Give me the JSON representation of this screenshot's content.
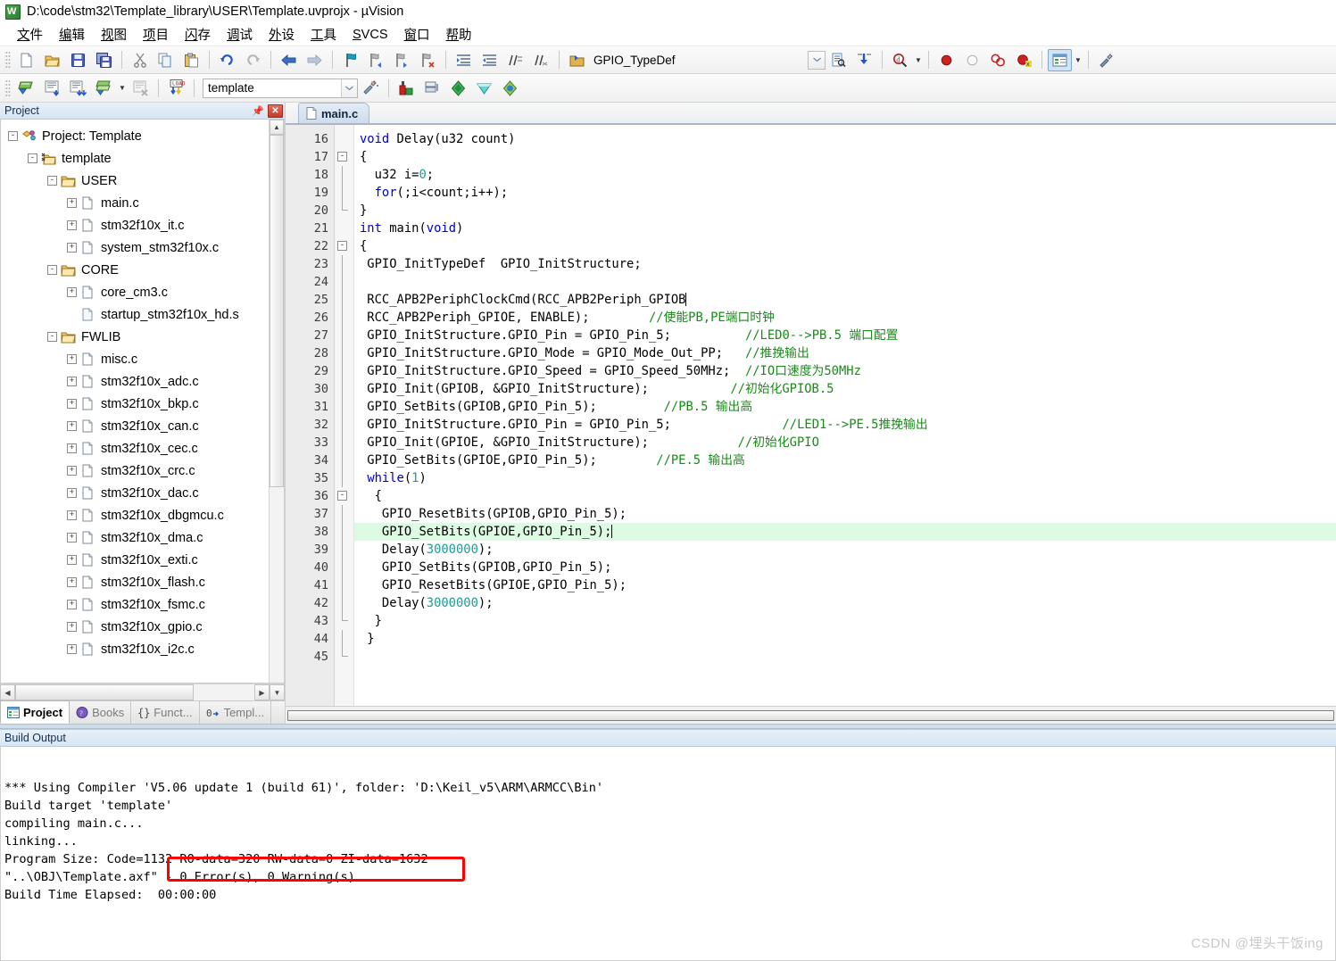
{
  "window": {
    "title": "D:\\code\\stm32\\Template_library\\USER\\Template.uvprojx - µVision",
    "app_icon": "uvision-icon"
  },
  "menu": [
    {
      "label": "文件"
    },
    {
      "label": "编辑"
    },
    {
      "label": "视图"
    },
    {
      "label": "项目"
    },
    {
      "label": "闪存"
    },
    {
      "label": "调试"
    },
    {
      "label": "外设"
    },
    {
      "label": "工具"
    },
    {
      "label": "SVCS"
    },
    {
      "label": "窗口"
    },
    {
      "label": "帮助"
    }
  ],
  "toolbar1": {
    "symbol_field": "GPIO_TypeDef",
    "buttons": [
      "new-file-icon",
      "open-file-icon",
      "save-icon",
      "save-all-icon",
      "cut-icon",
      "copy-icon",
      "paste-icon",
      "undo-icon",
      "redo-icon",
      "navigate-back-icon",
      "navigate-forward-icon",
      "bookmark-toggle-icon",
      "bookmark-prev-icon",
      "bookmark-next-icon",
      "bookmark-clear-icon",
      "indent-icon",
      "outdent-icon",
      "comment-icon",
      "uncomment-icon",
      "browse-symbol-icon"
    ],
    "right_buttons": [
      "find-in-files-icon",
      "goto-definition-icon",
      "find-icon",
      "breakpoint-insert-icon",
      "breakpoint-disable-icon",
      "breakpoint-kill-all-icon",
      "breakpoint-disable-all-icon",
      "manage-windows-icon",
      "configuration-wizard-icon"
    ]
  },
  "toolbar2": {
    "target_name": "template",
    "buttons": [
      "translate-icon",
      "build-icon",
      "rebuild-icon",
      "batch-build-icon",
      "stop-build-icon",
      "download-icon"
    ],
    "right_buttons": [
      "target-options-icon",
      "manage-project-items-icon",
      "pack-installer-icon",
      "manage-runtime-env-icon",
      "select-software-packs-icon"
    ]
  },
  "project_panel": {
    "title": "Project",
    "pin_icon": "pin-icon",
    "close_icon": "close-icon",
    "tree": [
      {
        "label": "Project: Template",
        "indent": 0,
        "expander": "-",
        "icon": "project-icon"
      },
      {
        "label": "template",
        "indent": 1,
        "expander": "-",
        "icon": "target-icon"
      },
      {
        "label": "USER",
        "indent": 2,
        "expander": "-",
        "icon": "folder-icon"
      },
      {
        "label": "main.c",
        "indent": 3,
        "expander": "+",
        "icon": "c-file-icon"
      },
      {
        "label": "stm32f10x_it.c",
        "indent": 3,
        "expander": "+",
        "icon": "c-file-icon"
      },
      {
        "label": "system_stm32f10x.c",
        "indent": 3,
        "expander": "+",
        "icon": "c-file-icon"
      },
      {
        "label": "CORE",
        "indent": 2,
        "expander": "-",
        "icon": "folder-icon"
      },
      {
        "label": "core_cm3.c",
        "indent": 3,
        "expander": "+",
        "icon": "c-file-icon"
      },
      {
        "label": "startup_stm32f10x_hd.s",
        "indent": 3,
        "expander": "",
        "icon": "asm-file-icon"
      },
      {
        "label": "FWLIB",
        "indent": 2,
        "expander": "-",
        "icon": "folder-icon"
      },
      {
        "label": "misc.c",
        "indent": 3,
        "expander": "+",
        "icon": "c-file-icon"
      },
      {
        "label": "stm32f10x_adc.c",
        "indent": 3,
        "expander": "+",
        "icon": "c-file-icon"
      },
      {
        "label": "stm32f10x_bkp.c",
        "indent": 3,
        "expander": "+",
        "icon": "c-file-icon"
      },
      {
        "label": "stm32f10x_can.c",
        "indent": 3,
        "expander": "+",
        "icon": "c-file-icon"
      },
      {
        "label": "stm32f10x_cec.c",
        "indent": 3,
        "expander": "+",
        "icon": "c-file-icon"
      },
      {
        "label": "stm32f10x_crc.c",
        "indent": 3,
        "expander": "+",
        "icon": "c-file-icon"
      },
      {
        "label": "stm32f10x_dac.c",
        "indent": 3,
        "expander": "+",
        "icon": "c-file-icon"
      },
      {
        "label": "stm32f10x_dbgmcu.c",
        "indent": 3,
        "expander": "+",
        "icon": "c-file-icon"
      },
      {
        "label": "stm32f10x_dma.c",
        "indent": 3,
        "expander": "+",
        "icon": "c-file-icon"
      },
      {
        "label": "stm32f10x_exti.c",
        "indent": 3,
        "expander": "+",
        "icon": "c-file-icon"
      },
      {
        "label": "stm32f10x_flash.c",
        "indent": 3,
        "expander": "+",
        "icon": "c-file-icon"
      },
      {
        "label": "stm32f10x_fsmc.c",
        "indent": 3,
        "expander": "+",
        "icon": "c-file-icon"
      },
      {
        "label": "stm32f10x_gpio.c",
        "indent": 3,
        "expander": "+",
        "icon": "c-file-icon"
      },
      {
        "label": "stm32f10x_i2c.c",
        "indent": 3,
        "expander": "+",
        "icon": "c-file-icon"
      }
    ],
    "tabs": [
      {
        "label": "Project",
        "icon": "project-tab-icon",
        "active": true
      },
      {
        "label": "Books",
        "icon": "books-tab-icon",
        "active": false
      },
      {
        "label": "Funct...",
        "icon": "functions-tab-icon",
        "active": false
      },
      {
        "label": "Templ...",
        "icon": "templates-tab-icon",
        "active": false
      }
    ]
  },
  "editor": {
    "tab": {
      "label": "main.c",
      "icon": "c-file-icon"
    },
    "first_line": 16,
    "highlight_line": 38,
    "caret_line": 38,
    "lines": [
      {
        "n": 16,
        "fold": "",
        "tokens": [
          {
            "t": "kw",
            "s": "void "
          },
          {
            "t": "p",
            "s": "Delay(u32 count)"
          }
        ]
      },
      {
        "n": 17,
        "fold": "-",
        "tokens": [
          {
            "t": "p",
            "s": "{"
          }
        ]
      },
      {
        "n": 18,
        "fold": "|",
        "tokens": [
          {
            "t": "p",
            "s": "  u32 i="
          },
          {
            "t": "num",
            "s": "0"
          },
          {
            "t": "p",
            "s": ";"
          }
        ]
      },
      {
        "n": 19,
        "fold": "|",
        "tokens": [
          {
            "t": "p",
            "s": "  "
          },
          {
            "t": "kw",
            "s": "for"
          },
          {
            "t": "p",
            "s": "(;i<count;i++);"
          }
        ]
      },
      {
        "n": 20,
        "fold": "e",
        "tokens": [
          {
            "t": "p",
            "s": "}"
          }
        ]
      },
      {
        "n": 21,
        "fold": "",
        "tokens": [
          {
            "t": "kw",
            "s": "int "
          },
          {
            "t": "p",
            "s": "main("
          },
          {
            "t": "kw",
            "s": "void"
          },
          {
            "t": "p",
            "s": ")"
          }
        ]
      },
      {
        "n": 22,
        "fold": "-",
        "tokens": [
          {
            "t": "p",
            "s": "{"
          }
        ]
      },
      {
        "n": 23,
        "fold": "|",
        "tokens": [
          {
            "t": "p",
            "s": " GPIO_InitTypeDef  GPIO_InitStructure;"
          }
        ]
      },
      {
        "n": 24,
        "fold": "|",
        "tokens": [
          {
            "t": "p",
            "s": ""
          }
        ]
      },
      {
        "n": 25,
        "fold": "|",
        "tokens": [
          {
            "t": "p",
            "s": " RCC_APB2PeriphClockCmd(RCC_APB2Periph_GPIOB"
          },
          {
            "t": "caret",
            "s": ""
          }
        ]
      },
      {
        "n": 26,
        "fold": "|",
        "tokens": [
          {
            "t": "p",
            "s": " RCC_APB2Periph_GPIOE, ENABLE);        "
          },
          {
            "t": "cmt",
            "s": "//使能PB,PE端口时钟"
          }
        ]
      },
      {
        "n": 27,
        "fold": "|",
        "tokens": [
          {
            "t": "p",
            "s": " GPIO_InitStructure.GPIO_Pin = GPIO_Pin_5;          "
          },
          {
            "t": "cmt",
            "s": "//LED0-->PB.5 端口配置"
          }
        ]
      },
      {
        "n": 28,
        "fold": "|",
        "tokens": [
          {
            "t": "p",
            "s": " GPIO_InitStructure.GPIO_Mode = GPIO_Mode_Out_PP;   "
          },
          {
            "t": "cmt",
            "s": "//推挽输出"
          }
        ]
      },
      {
        "n": 29,
        "fold": "|",
        "tokens": [
          {
            "t": "p",
            "s": " GPIO_InitStructure.GPIO_Speed = GPIO_Speed_50MHz;  "
          },
          {
            "t": "cmt",
            "s": "//IO口速度为50MHz"
          }
        ]
      },
      {
        "n": 30,
        "fold": "|",
        "tokens": [
          {
            "t": "p",
            "s": " GPIO_Init(GPIOB, &GPIO_InitStructure);           "
          },
          {
            "t": "cmt",
            "s": "//初始化GPIOB.5"
          }
        ]
      },
      {
        "n": 31,
        "fold": "|",
        "tokens": [
          {
            "t": "p",
            "s": " GPIO_SetBits(GPIOB,GPIO_Pin_5);         "
          },
          {
            "t": "cmt",
            "s": "//PB.5 输出高"
          }
        ]
      },
      {
        "n": 32,
        "fold": "|",
        "tokens": [
          {
            "t": "p",
            "s": " GPIO_InitStructure.GPIO_Pin = GPIO_Pin_5;               "
          },
          {
            "t": "cmt",
            "s": "//LED1-->PE.5推挽输出"
          }
        ]
      },
      {
        "n": 33,
        "fold": "|",
        "tokens": [
          {
            "t": "p",
            "s": " GPIO_Init(GPIOE, &GPIO_InitStructure);            "
          },
          {
            "t": "cmt",
            "s": "//初始化GPIO"
          }
        ]
      },
      {
        "n": 34,
        "fold": "|",
        "tokens": [
          {
            "t": "p",
            "s": " GPIO_SetBits(GPIOE,GPIO_Pin_5);        "
          },
          {
            "t": "cmt",
            "s": "//PE.5 输出高"
          }
        ]
      },
      {
        "n": 35,
        "fold": "|",
        "tokens": [
          {
            "t": "p",
            "s": " "
          },
          {
            "t": "kw",
            "s": "while"
          },
          {
            "t": "p",
            "s": "("
          },
          {
            "t": "num",
            "s": "1"
          },
          {
            "t": "p",
            "s": ")"
          }
        ]
      },
      {
        "n": 36,
        "fold": "-",
        "tokens": [
          {
            "t": "p",
            "s": "  {"
          }
        ]
      },
      {
        "n": 37,
        "fold": "|",
        "tokens": [
          {
            "t": "p",
            "s": "   GPIO_ResetBits(GPIOB,GPIO_Pin_5);"
          }
        ]
      },
      {
        "n": 38,
        "fold": "|",
        "tokens": [
          {
            "t": "p",
            "s": "   GPIO_SetBits(GPIOE,GPIO_Pin_5);"
          },
          {
            "t": "caret",
            "s": ""
          }
        ]
      },
      {
        "n": 39,
        "fold": "|",
        "tokens": [
          {
            "t": "p",
            "s": "   Delay("
          },
          {
            "t": "num",
            "s": "3000000"
          },
          {
            "t": "p",
            "s": ");"
          }
        ]
      },
      {
        "n": 40,
        "fold": "|",
        "tokens": [
          {
            "t": "p",
            "s": "   GPIO_SetBits(GPIOB,GPIO_Pin_5);"
          }
        ]
      },
      {
        "n": 41,
        "fold": "|",
        "tokens": [
          {
            "t": "p",
            "s": "   GPIO_ResetBits(GPIOE,GPIO_Pin_5);"
          }
        ]
      },
      {
        "n": 42,
        "fold": "|",
        "tokens": [
          {
            "t": "p",
            "s": "   Delay("
          },
          {
            "t": "num",
            "s": "3000000"
          },
          {
            "t": "p",
            "s": ");"
          }
        ]
      },
      {
        "n": 43,
        "fold": "e",
        "tokens": [
          {
            "t": "p",
            "s": "  }"
          }
        ]
      },
      {
        "n": 44,
        "fold": "|",
        "tokens": [
          {
            "t": "p",
            "s": " }"
          }
        ]
      },
      {
        "n": 45,
        "fold": "e",
        "tokens": [
          {
            "t": "p",
            "s": ""
          }
        ]
      }
    ]
  },
  "build_output": {
    "title": "Build Output",
    "lines": [
      "*** Using Compiler 'V5.06 update 1 (build 61)', folder: 'D:\\Keil_v5\\ARM\\ARMCC\\Bin'",
      "Build target 'template'",
      "compiling main.c...",
      "linking...",
      "Program Size: Code=1132 RO-data=320 RW-data=0 ZI-data=1632",
      "\"..\\OBJ\\Template.axf\" - 0 Error(s), 0 Warning(s).",
      "Build Time Elapsed:  00:00:00"
    ],
    "annotation": {
      "color": "#ff0000",
      "shape": "rectangle",
      "target_text": "f\" - 0 Error(s), 0 Warning(s)."
    }
  },
  "watermark": {
    "text": "CSDN @埋头干饭ing",
    "color": "#c9c9c9"
  }
}
